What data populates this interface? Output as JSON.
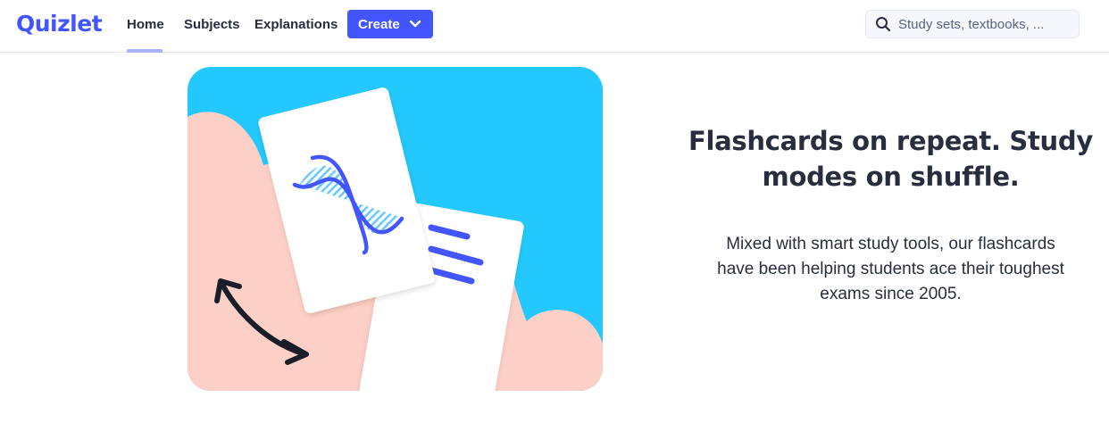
{
  "header": {
    "logo": "Quizlet",
    "nav": {
      "home": "Home",
      "subjects": "Subjects",
      "explanations": "Explanations"
    },
    "create_label": "Create",
    "search": {
      "placeholder": "Study sets, textbooks, ..."
    }
  },
  "hero": {
    "headline_line1": "Flashcards on repeat. Study",
    "headline_line2": "modes on shuffle.",
    "description_line1": "Mixed with smart study tools, our flashcards",
    "description_line2": "have been helping students ace their toughest",
    "description_line3": "exams since 2005.",
    "illustration": {
      "background_color": "#23c9fe",
      "cloud_color": "#fdd0c7",
      "accent_color": "#4255ff",
      "icons": [
        "dna-icon",
        "text-lines-icon",
        "swap-arrow-icon"
      ]
    }
  },
  "colors": {
    "brand": "#4255ff",
    "text": "#282e3e",
    "active_underline": "#a8b1ff"
  }
}
